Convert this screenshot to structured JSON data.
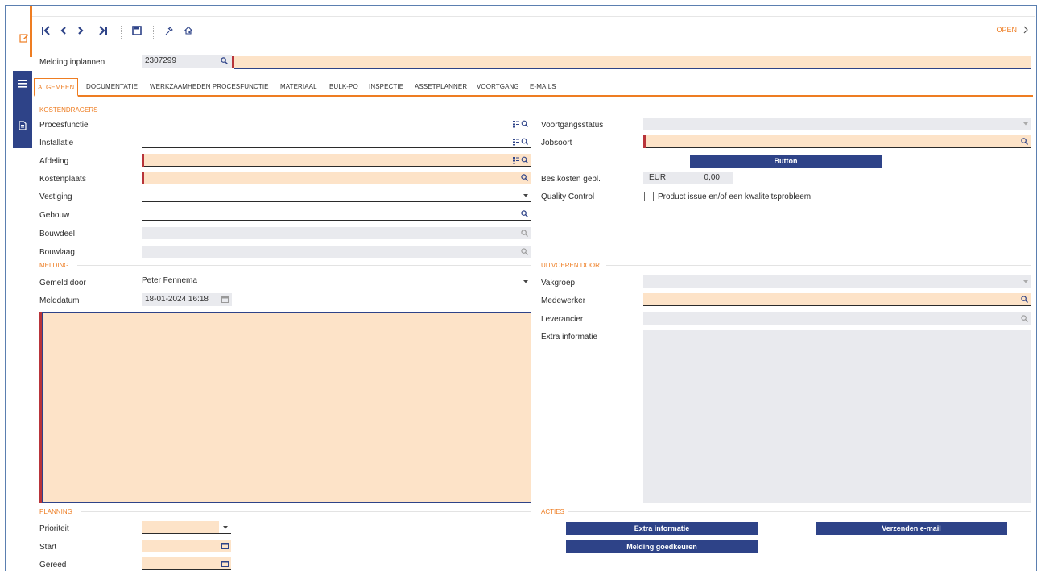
{
  "toolbar": {
    "status_link": "OPEN"
  },
  "header": {
    "title_label": "Melding inplannen",
    "record_id": "2307299"
  },
  "tabs": [
    {
      "label": "ALGEMEEN"
    },
    {
      "label": "DOCUMENTATIE"
    },
    {
      "label": "WERKZAAMHEDEN PROCESFUNCTIE"
    },
    {
      "label": "MATERIAAL"
    },
    {
      "label": "BULK-PO"
    },
    {
      "label": "INSPECTIE"
    },
    {
      "label": "ASSETPLANNER"
    },
    {
      "label": "VOORTGANG"
    },
    {
      "label": "E-MAILS"
    }
  ],
  "sections": {
    "kostendragers": "KOSTENDRAGERS",
    "melding": "MELDING",
    "planning": "PLANNING",
    "uitvoeren_door": "UITVOEREN DOOR",
    "acties": "ACTIES"
  },
  "left_fields": {
    "procesfunctie": "Procesfunctie",
    "installatie": "Installatie",
    "afdeling": "Afdeling",
    "kostenplaats": "Kostenplaats",
    "vestiging": "Vestiging",
    "gebouw": "Gebouw",
    "bouwdeel": "Bouwdeel",
    "bouwlaag": "Bouwlaag",
    "gemeld_door": "Gemeld door",
    "gemeld_door_value": "Peter Fennema",
    "melddatum": "Melddatum",
    "melddatum_value": "18-01-2024 16:18",
    "prioriteit": "Prioriteit",
    "start": "Start",
    "gereed": "Gereed"
  },
  "right_fields": {
    "voortgangsstatus": "Voortgangsstatus",
    "jobsoort": "Jobsoort",
    "button": "Button",
    "bes_kosten": "Bes.kosten gepl.",
    "currency": "EUR",
    "amount": "0,00",
    "quality_control": "Quality Control",
    "quality_checkbox_label": "Product issue en/of een kwaliteitsprobleem",
    "vakgroep": "Vakgroep",
    "medewerker": "Medewerker",
    "leverancier": "Leverancier",
    "extra_informatie": "Extra informatie"
  },
  "actions": {
    "extra_informatie": "Extra informatie",
    "verzenden_email": "Verzenden e-mail",
    "melding_goedkeuren": "Melding goedkeuren"
  },
  "colors": {
    "accent": "#ee7d22",
    "primary": "#2e4388",
    "required_fill": "#fde3c8",
    "required_marker": "#b8343a",
    "disabled_fill": "#e9eaee"
  },
  "icons": [
    "edit-icon",
    "menu-icon",
    "document-icon",
    "first-record-icon",
    "previous-record-icon",
    "next-record-icon",
    "last-record-icon",
    "save-icon",
    "pin-icon",
    "home-icon",
    "chevron-right-icon",
    "search-icon",
    "tree-search-icon",
    "dropdown-arrow-icon",
    "calendar-icon"
  ]
}
